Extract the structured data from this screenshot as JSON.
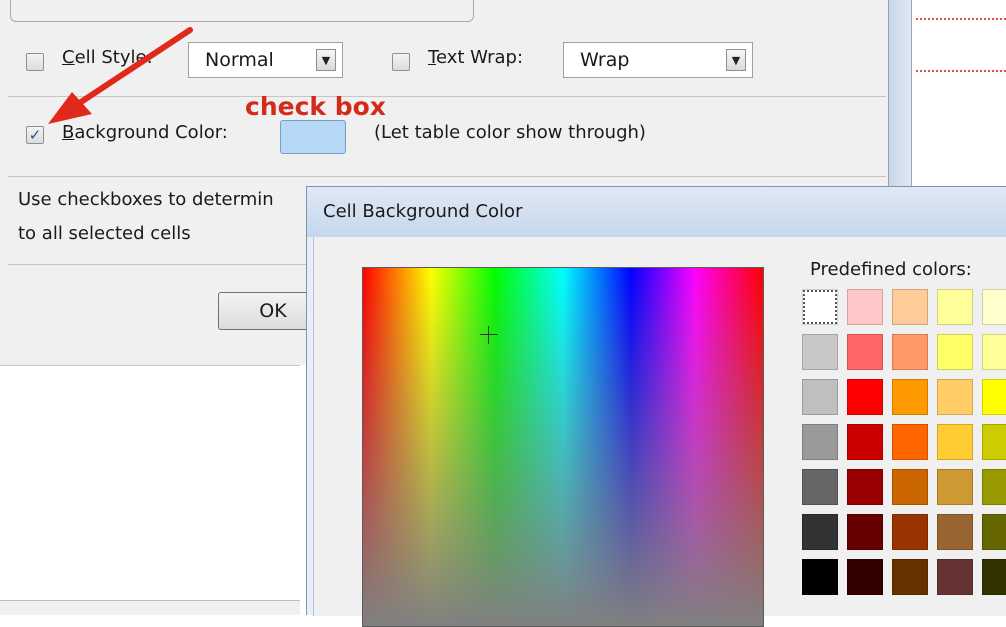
{
  "table_props": {
    "cell_style": {
      "label_pre": "",
      "label_ul": "C",
      "label_post": "ell Style:",
      "value": "Normal",
      "checked": false
    },
    "text_wrap": {
      "label_pre": "",
      "label_ul": "T",
      "label_post": "ext Wrap:",
      "value": "Wrap",
      "checked": false
    },
    "background_color": {
      "label_pre": "",
      "label_ul": "B",
      "label_post": "ackground Color:",
      "checked": true,
      "swatch_color": "#b4d8f5",
      "note": "(Let table color show through)"
    },
    "help_line1": "Use checkboxes to determin",
    "help_line2": "to all selected cells",
    "ok_label": "OK"
  },
  "annotation": {
    "text": "check box",
    "color": "#d42a1c"
  },
  "color_dialog": {
    "title": "Cell Background Color",
    "predefined_label": "Predefined colors:",
    "palette": [
      [
        "#ffffff",
        "#ffc8c8",
        "#ffcc99",
        "#ffff99",
        "#ffffcc"
      ],
      [
        "#c8c8c8",
        "#ff6666",
        "#ff9966",
        "#ffff66",
        "#ffff99"
      ],
      [
        "#bfbfbf",
        "#ff0000",
        "#ff9900",
        "#ffcc66",
        "#ffff00"
      ],
      [
        "#999999",
        "#cc0000",
        "#ff6600",
        "#ffcc33",
        "#cccc00"
      ],
      [
        "#666666",
        "#990000",
        "#cc6600",
        "#cc9933",
        "#999900"
      ],
      [
        "#333333",
        "#660000",
        "#993300",
        "#996633",
        "#666600"
      ],
      [
        "#000000",
        "#330000",
        "#663300",
        "#663333",
        "#333300"
      ]
    ]
  }
}
